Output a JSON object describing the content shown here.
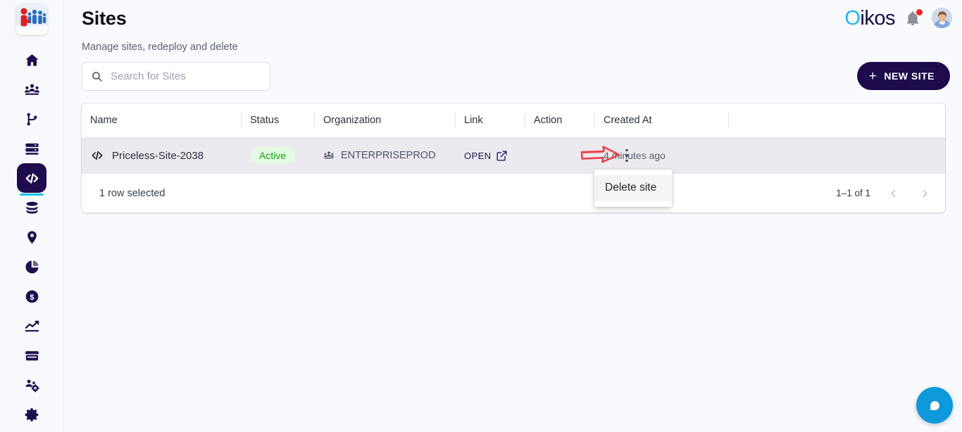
{
  "app": {
    "logo_alt": "company-people-logo",
    "brand_o": "O",
    "brand_rest": "ikos",
    "accent_cyan": "#18b8f0",
    "brand_navy": "#1d0b4e",
    "notification_badge": "1"
  },
  "sidebar": {
    "items": [
      {
        "icon": "home-icon",
        "label": "Home",
        "active": false
      },
      {
        "icon": "people-group-icon",
        "label": "Teams",
        "active": false
      },
      {
        "icon": "git-branch-icon",
        "label": "Pipelines",
        "active": false
      },
      {
        "icon": "server-stack-icon",
        "label": "Servers",
        "active": false
      },
      {
        "icon": "code-brackets-icon",
        "label": "Sites",
        "active": true
      },
      {
        "icon": "database-icon",
        "label": "Databases",
        "active": false
      },
      {
        "icon": "map-pin-icon",
        "label": "Locations",
        "active": false
      },
      {
        "icon": "pie-chart-icon",
        "label": "Reports",
        "active": false
      },
      {
        "icon": "dollar-circle-icon",
        "label": "Billing",
        "active": false
      },
      {
        "icon": "trending-up-icon",
        "label": "Analytics",
        "active": false
      },
      {
        "icon": "store-icon",
        "label": "Marketplace",
        "active": false
      },
      {
        "icon": "users-settings-icon",
        "label": "User Management",
        "active": false
      },
      {
        "icon": "gear-icon",
        "label": "Settings",
        "active": false
      }
    ]
  },
  "header": {
    "title": "Sites",
    "subtitle": "Manage sites, redeploy and delete"
  },
  "search": {
    "placeholder": "Search for Sites",
    "value": ""
  },
  "actions": {
    "new_site_label": "NEW SITE",
    "new_site_plus": "+"
  },
  "table": {
    "columns": [
      "Name",
      "Status",
      "Organization",
      "Link",
      "Action",
      "Created At"
    ],
    "rows": [
      {
        "name": "Priceless-Site-2038",
        "status": "Active",
        "status_color": "#15a015",
        "status_bg": "#e3fbe3",
        "organization": "ENTERPRISEPROD",
        "link_label": "OPEN",
        "created_at": "4 minutes ago",
        "selected": true
      }
    ],
    "footer": {
      "rows_selected": "1 row selected",
      "page_label": "1–1 of 1"
    }
  },
  "context_menu": {
    "visible": true,
    "items": [
      {
        "label": "Delete site"
      }
    ]
  },
  "annotation": {
    "type": "red-arrow",
    "color": "#e8414a",
    "points_to": "row-actions-kebab-menu"
  },
  "chat": {
    "label": "chat-bubble-icon",
    "color": "#0e99dc"
  }
}
